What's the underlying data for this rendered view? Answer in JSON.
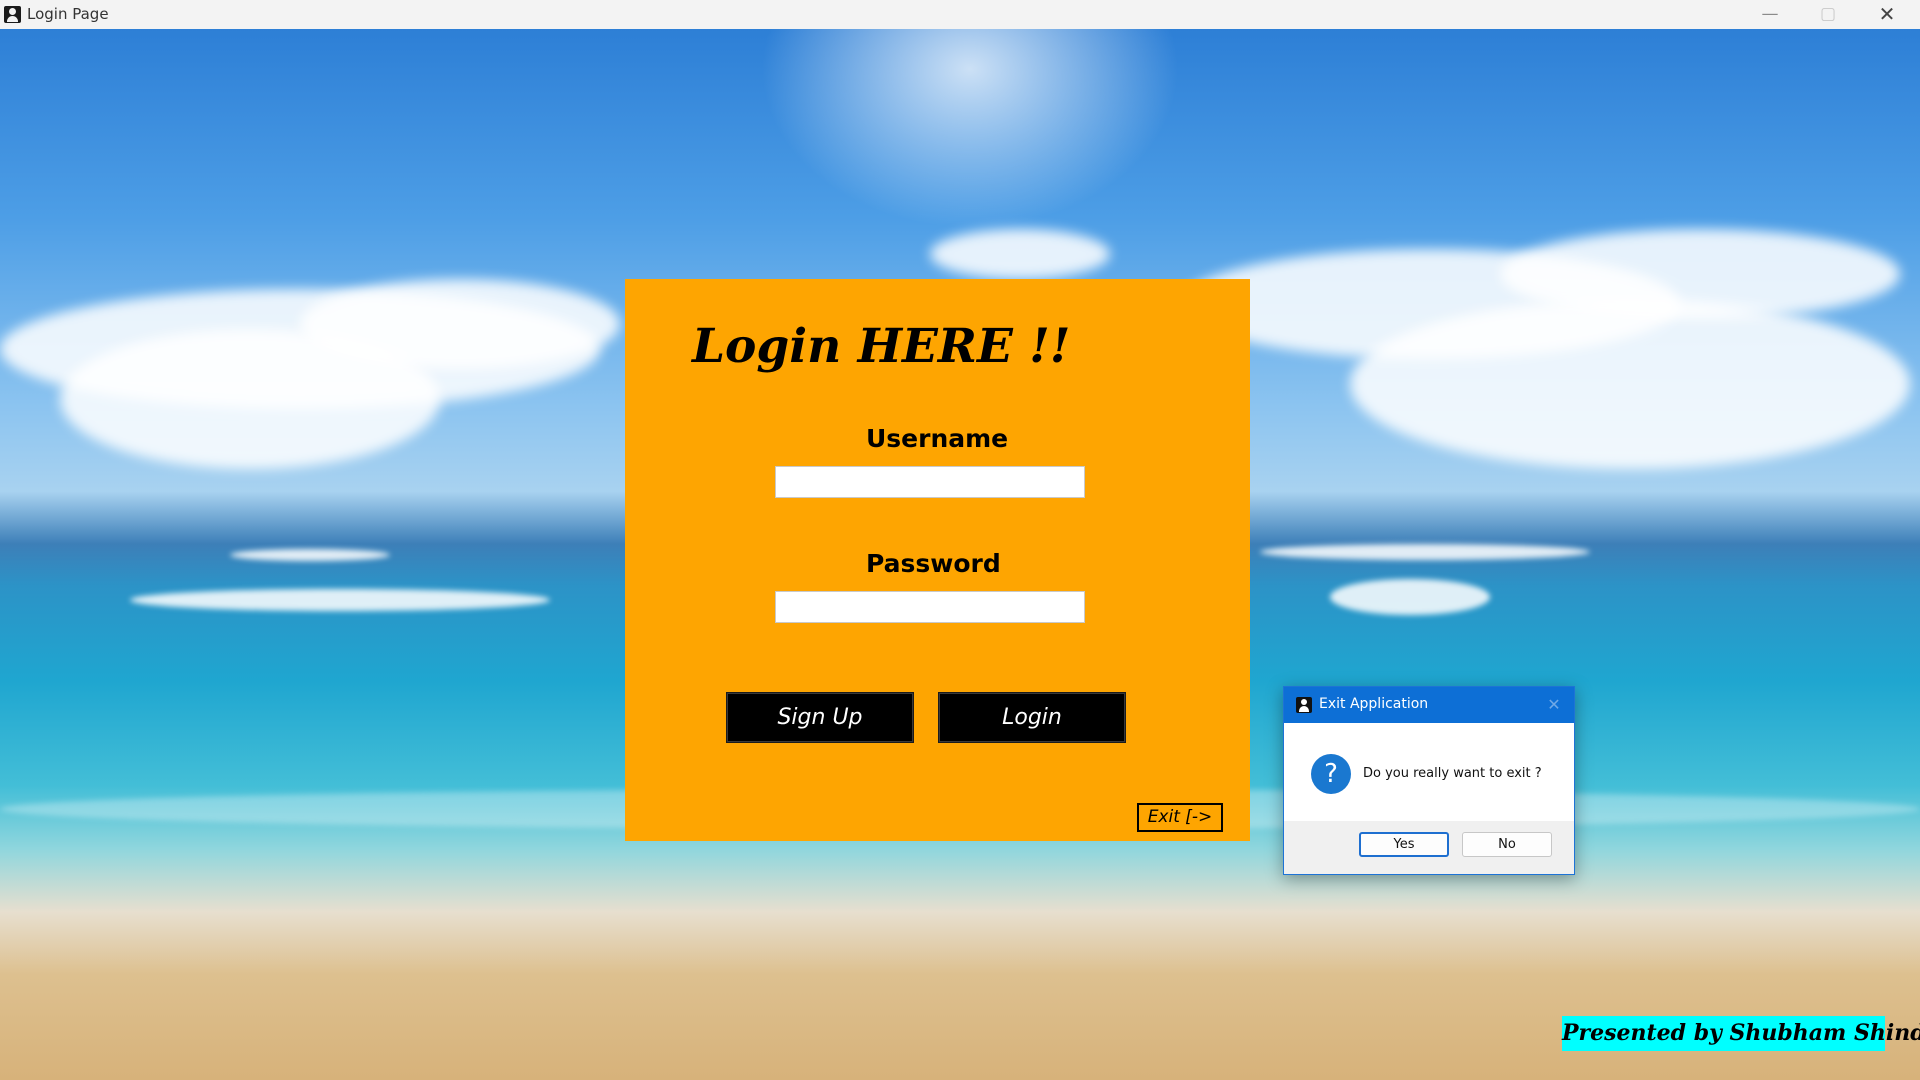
{
  "window": {
    "title": "Login Page",
    "minimize": "—",
    "maximize": "▢",
    "close": "✕"
  },
  "login": {
    "title": "Login HERE !!",
    "username_label": "Username",
    "username_value": "",
    "password_label": "Password",
    "password_value": "",
    "signup_label": "Sign Up",
    "login_label": "Login",
    "exit_label": "Exit [->"
  },
  "presenter": "Presented by Shubham Shinde",
  "dialog": {
    "title": "Exit Application",
    "close": "✕",
    "icon": "question-icon",
    "icon_glyph": "?",
    "message": "Do you really want to exit ?",
    "yes_label": "Yes",
    "no_label": "No"
  },
  "colors": {
    "panel": "#fea501",
    "presenter_bg": "#00ffff",
    "dialog_title_bar": "#0d6fd6"
  }
}
